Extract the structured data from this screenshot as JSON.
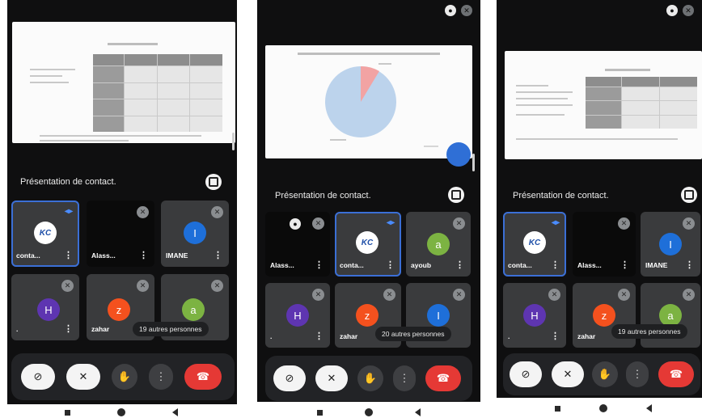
{
  "presentation_label": "Présentation de contact.",
  "icons": {
    "mic_off": "mic-off-icon",
    "speaking": "speaking-indicator-icon",
    "expand": "expand-icon",
    "camera_off": "camera-off-icon",
    "hand": "raise-hand-icon",
    "more": "more-vert-icon",
    "hang_up": "hang-up-icon"
  },
  "colors": {
    "background": "#0f0f10",
    "tile": "#3a3b3d",
    "active_border": "#3b6fd6",
    "hang_up": "#e53935",
    "avatar_purple": "#5e35b1",
    "avatar_orange": "#f4511e",
    "avatar_green": "#7cb342",
    "avatar_blue": "#1e6fd9"
  },
  "screens": [
    {
      "tiles": [
        {
          "name": "conta...",
          "logo": "KC"
        },
        {
          "name": "Alass..."
        },
        {
          "name": "IMANE",
          "initial": "I"
        },
        {
          "name": ".",
          "initial": "H"
        },
        {
          "name": "zahar",
          "initial": "z"
        },
        {
          "name": "",
          "initial": "a"
        }
      ],
      "others": "19 autres personnes"
    },
    {
      "tiles": [
        {
          "name": "Alass..."
        },
        {
          "name": "conta...",
          "logo": "KC"
        },
        {
          "name": "ayoub",
          "initial": "a"
        },
        {
          "name": ".",
          "initial": "H"
        },
        {
          "name": "zahar",
          "initial": "z"
        },
        {
          "name": "",
          "initial": "I"
        }
      ],
      "others": "20 autres personnes"
    },
    {
      "tiles": [
        {
          "name": "conta...",
          "logo": "KC"
        },
        {
          "name": "Alass..."
        },
        {
          "name": "IMANE",
          "initial": "I"
        },
        {
          "name": ".",
          "initial": "H"
        },
        {
          "name": "zahar",
          "initial": "z"
        },
        {
          "name": "",
          "initial": "a"
        }
      ],
      "others": "19 autres personnes"
    }
  ]
}
